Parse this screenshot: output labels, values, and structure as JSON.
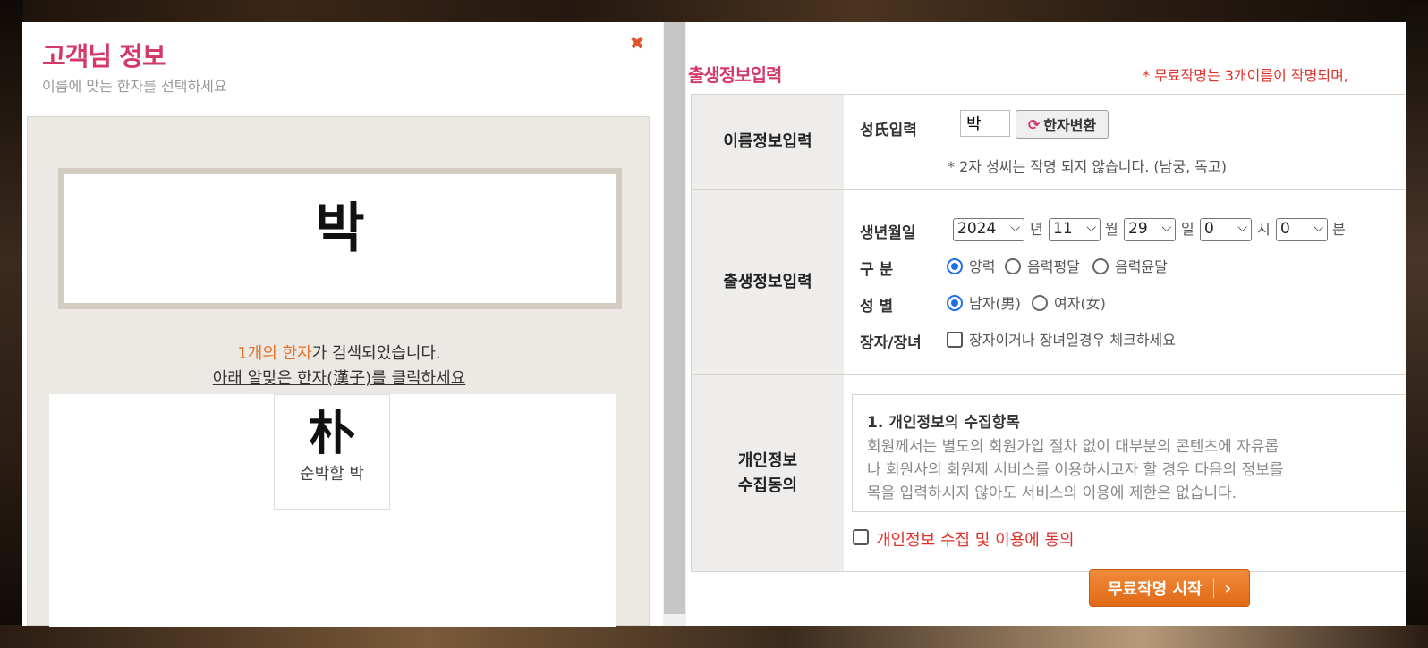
{
  "popup": {
    "title": "고객님 정보",
    "subtitle": "이름에 맞는 한자를 선택하세요",
    "close_icon": "close-icon",
    "selected_char": "박",
    "found_highlight": "1개의 한자",
    "found_rest": "가 검색되었습니다.",
    "click_instruction": "아래 알맞은 한자(漢子)를 클릭하세요",
    "results": [
      {
        "hanja": "朴",
        "meaning": "순박할 박"
      }
    ]
  },
  "form": {
    "title": "출생정보입력",
    "notice": "* 무료작명는 3개이름이 작명되며,",
    "name_section": {
      "header": "이름정보입력",
      "surname_label": "성氏입력",
      "surname_value": "박",
      "convert_button": "한자변환",
      "note": "* 2자 성씨는 작명 되지 않습니다. (남궁, 독고)"
    },
    "birth_section": {
      "header": "출생정보입력",
      "birth_label": "생년월일",
      "year": "2024",
      "year_unit": "년",
      "month": "11",
      "month_unit": "월",
      "day": "29",
      "day_unit": "일",
      "hour": "0",
      "hour_unit": "시",
      "minute": "0",
      "minute_unit": "분",
      "calendar_label": "구 분",
      "calendar_options": [
        "양력",
        "음력평달",
        "음력윤달"
      ],
      "calendar_selected": "양력",
      "gender_label": "성 별",
      "gender_options": [
        "남자(男)",
        "여자(女)"
      ],
      "gender_selected": "남자(男)",
      "eldest_label": "장자/장녀",
      "eldest_text": "장자이거나 장녀일경우 체크하세요"
    },
    "privacy_section": {
      "header_line1": "개인정보",
      "header_line2": "수집동의",
      "box_title": "1. 개인정보의 수집항목",
      "box_lines": [
        "회원께서는 별도의 회원가입 절차 없이 대부분의 콘텐츠에 자유롭",
        "나 회원사의 회원제 서비스를 이용하시고자 할 경우 다음의 정보를",
        "목을 입력하시지 않아도 서비스의 이용에 제한은 없습니다."
      ],
      "agree_label": "개인정보 수집 및 이용에 동의"
    },
    "start_button": "무료작명 시작"
  }
}
